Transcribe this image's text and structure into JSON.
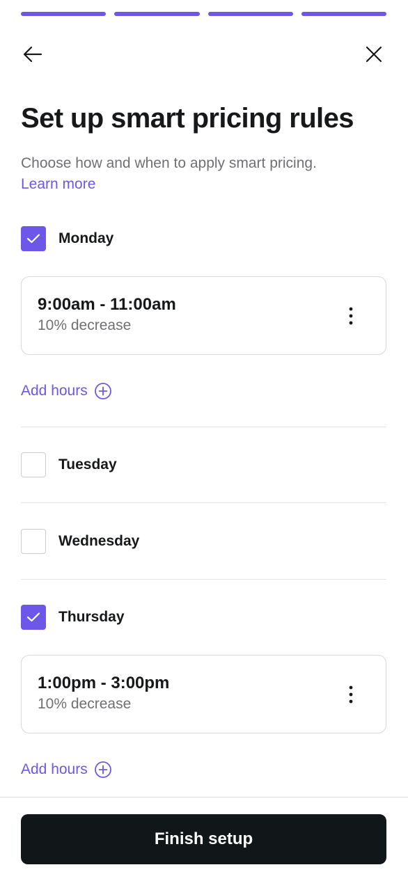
{
  "progress": {
    "total_steps": 4,
    "completed_steps": 4,
    "accent_color": "#6c57e8"
  },
  "header": {
    "back_icon": "arrow-left-icon",
    "close_icon": "close-icon"
  },
  "title": "Set up smart pricing rules",
  "subtitle": "Choose how and when to apply smart pricing.",
  "learn_more": "Learn more",
  "days": [
    {
      "label": "Monday",
      "checked": true,
      "hours": [
        {
          "range": "9:00am - 11:00am",
          "rule": "10% decrease"
        }
      ],
      "add_hours_label": "Add hours"
    },
    {
      "label": "Tuesday",
      "checked": false
    },
    {
      "label": "Wednesday",
      "checked": false
    },
    {
      "label": "Thursday",
      "checked": true,
      "hours": [
        {
          "range": "1:00pm - 3:00pm",
          "rule": "10% decrease"
        }
      ],
      "add_hours_label": "Add hours"
    }
  ],
  "footer": {
    "finish_label": "Finish setup",
    "button_color": "#111719"
  }
}
